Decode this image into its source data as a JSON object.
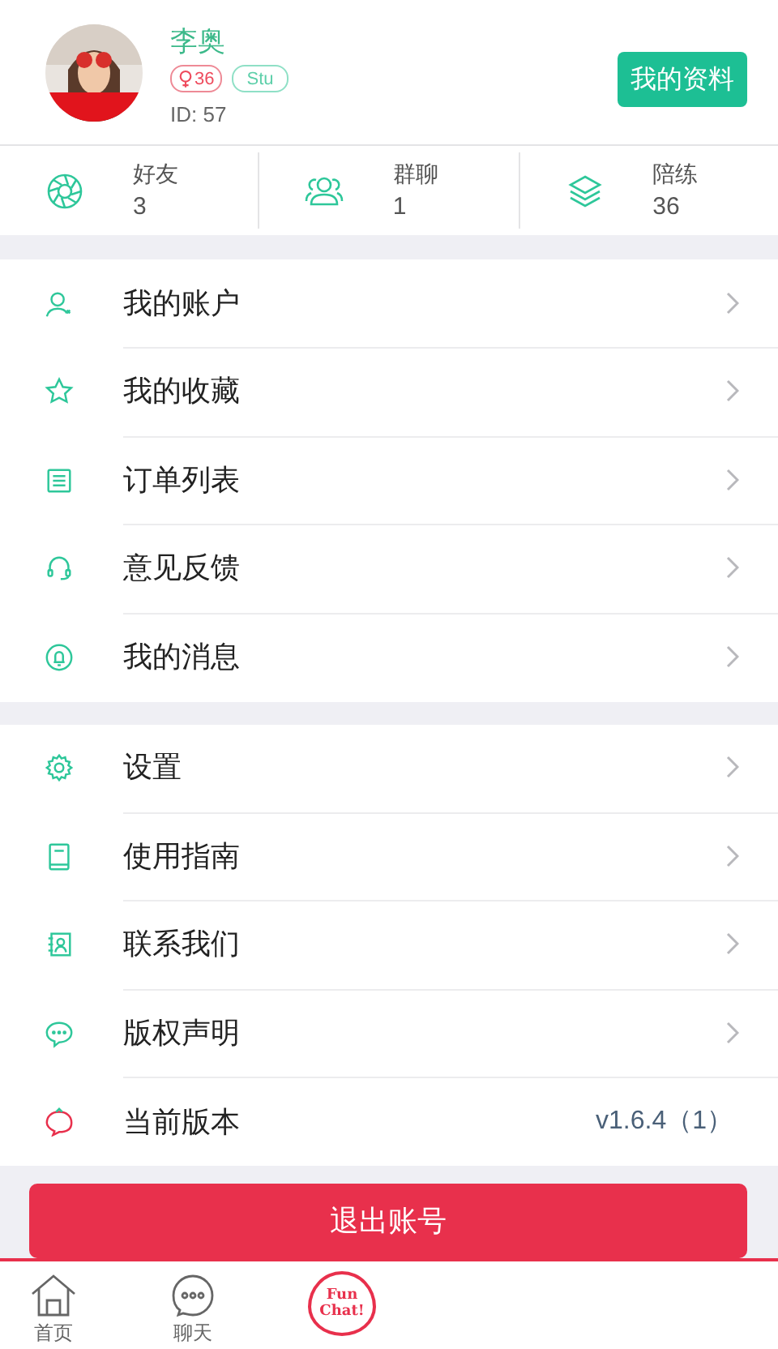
{
  "profile": {
    "name": "李奥",
    "badges": [
      {
        "kind": "level",
        "label": "36"
      },
      {
        "kind": "role",
        "label": "Stu"
      }
    ],
    "id": "ID: 57",
    "button": "我的资料"
  },
  "stats": [
    {
      "kind": "aperture",
      "label": "好友",
      "value": "3"
    },
    {
      "kind": "people",
      "label": "群聊",
      "value": "1"
    },
    {
      "kind": "layers",
      "label": "陪练",
      "value": "36"
    }
  ],
  "sections": [
    [
      {
        "kind": "account",
        "label": "我的账户"
      },
      {
        "kind": "star",
        "label": "我的收藏"
      },
      {
        "kind": "list",
        "label": "订单列表"
      },
      {
        "kind": "headset",
        "label": "意见反馈"
      },
      {
        "kind": "bell",
        "label": "我的消息"
      }
    ],
    [
      {
        "kind": "gear",
        "label": "设置"
      },
      {
        "kind": "book",
        "label": "使用指南"
      },
      {
        "kind": "contact",
        "label": "联系我们"
      },
      {
        "kind": "chat",
        "label": "版权声明"
      },
      {
        "kind": "logo",
        "label": "当前版本",
        "value": "v1.6.4（1）"
      }
    ]
  ],
  "logout": "退出账号",
  "tabbar": [
    {
      "kind": "home",
      "label": "首页"
    },
    {
      "kind": "chat",
      "label": "聊天"
    },
    {
      "kind": "logo",
      "label": "Fun Chat!"
    }
  ]
}
